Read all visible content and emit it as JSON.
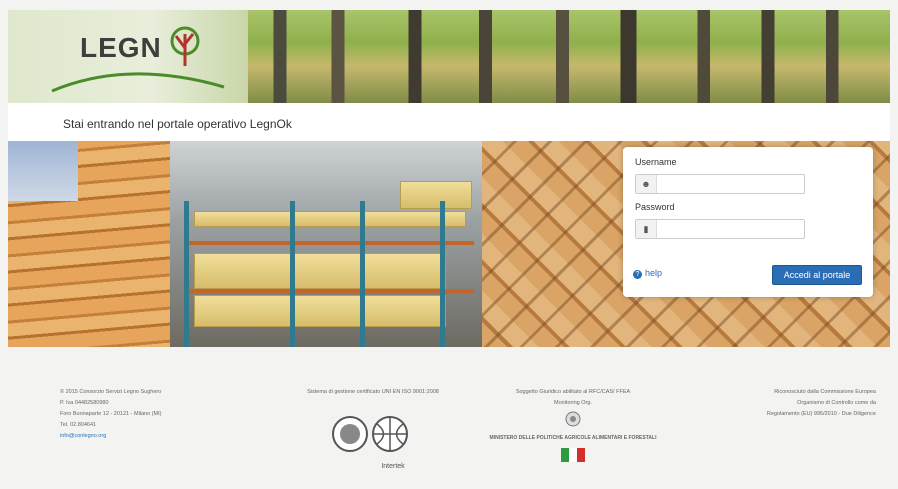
{
  "header": {
    "logo_text": "LEGN",
    "brand_colors": {
      "green": "#4a8c2a",
      "red": "#b2342a"
    }
  },
  "welcome": {
    "text": "Stai entrando nel portale operativo LegnOk"
  },
  "login": {
    "username_label": "Username",
    "username_value": "",
    "password_label": "Password",
    "password_value": "",
    "help_label": "help",
    "submit_label": "Accedi al portale",
    "accent": "#2a6db5"
  },
  "footer": {
    "col1": [
      "© 2015 Consorzio Servizi Legno Sughero",
      "P. Iva 04482580980",
      "Foro Buonaparte 12 - 20121 - Milano (MI)",
      "Tel. 02.804641"
    ],
    "col1_email": "info@conlegno.org",
    "col2_title": "Sistema di gestione certificato UNI EN ISO 9001:2008",
    "certifier": "Intertek",
    "col3_lines": [
      "Soggetto Giuridico abilitato al RFC/CAS/ FFEA",
      "Monitoring Org."
    ],
    "ministry": "MINISTERO DELLE POLITICHE AGRICOLE ALIMENTARI E FORESTALI",
    "col4": [
      "Riconosciuto dalla Commissione Europea",
      "Organismo di Controllo come da",
      "Regolamento (EU) 995/2010 - Due Diligence"
    ]
  }
}
